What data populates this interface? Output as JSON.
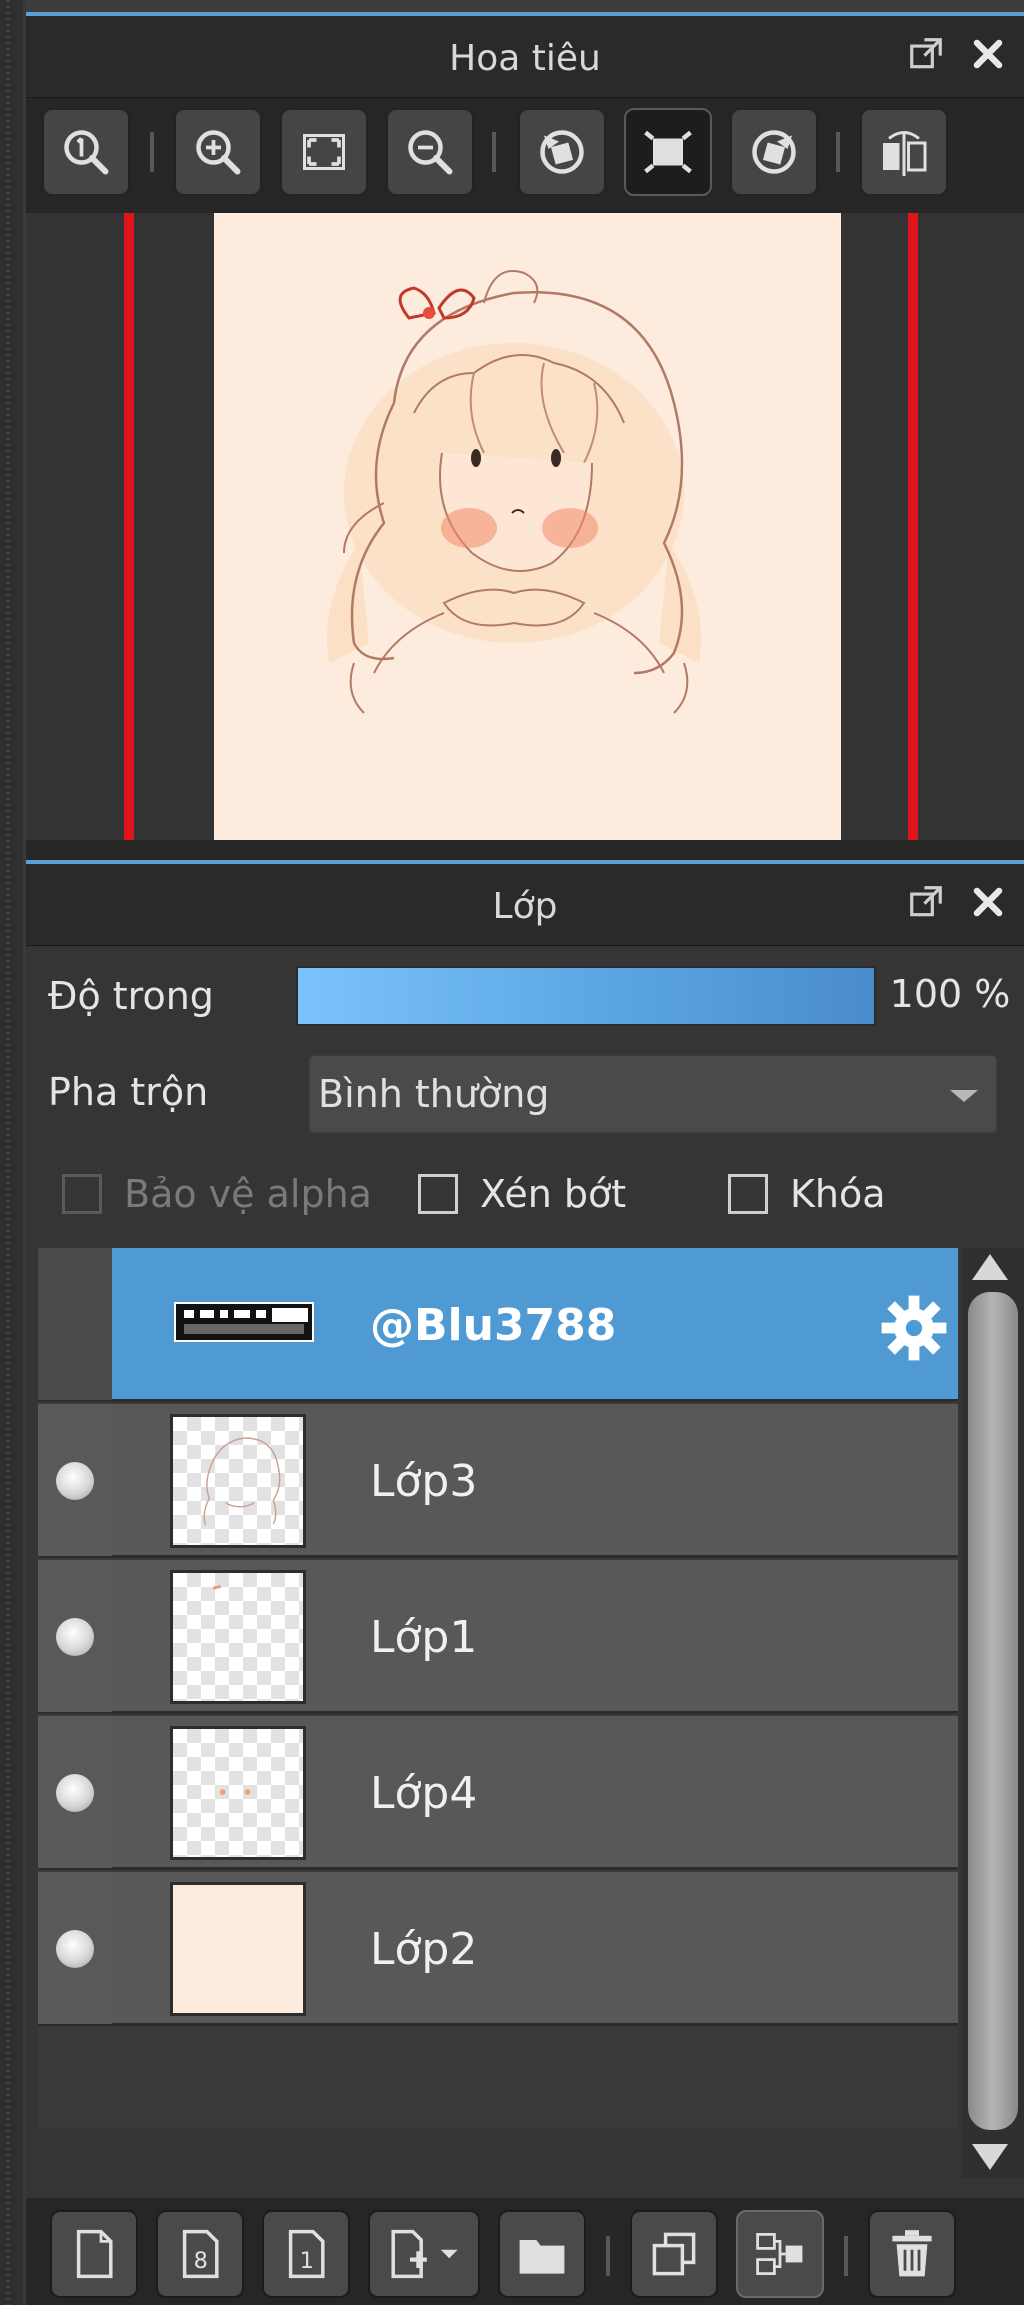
{
  "navigator": {
    "title": "Hoa tiêu",
    "toolbar_icons": [
      "zoom-reset-icon",
      "zoom-in-icon",
      "fit-screen-icon",
      "zoom-out-icon",
      "rotate-left-icon",
      "fit-window-icon",
      "rotate-right-icon",
      "flip-horizontal-icon"
    ]
  },
  "layers": {
    "title": "Lớp",
    "opacity_label": "Độ trong",
    "opacity_value": "100 %",
    "opacity_fraction": 1.0,
    "blend_label": "Pha trộn",
    "blend_value": "Bình thường",
    "protect_alpha_label": "Bảo vệ alpha",
    "clip_label": "Xén bớt",
    "lock_label": "Khóa",
    "items": [
      {
        "name": "@Blu3788",
        "selected": true
      },
      {
        "name": "Lớp3",
        "selected": false
      },
      {
        "name": "Lớp1",
        "selected": false
      },
      {
        "name": "Lớp4",
        "selected": false
      },
      {
        "name": "Lớp2",
        "selected": false
      }
    ],
    "bottom_toolbar_icons": [
      "new-layer-icon",
      "new-8bit-layer-icon",
      "new-1bit-layer-icon",
      "add-layer-menu-icon",
      "new-folder-icon",
      "duplicate-layer-icon",
      "merge-layer-icon",
      "delete-layer-icon"
    ]
  },
  "colors": {
    "accent": "#5a9fd6",
    "selected_row": "#509ad4",
    "canvas_bg": "#fdebdd",
    "nav_frame": "#e0141b"
  }
}
